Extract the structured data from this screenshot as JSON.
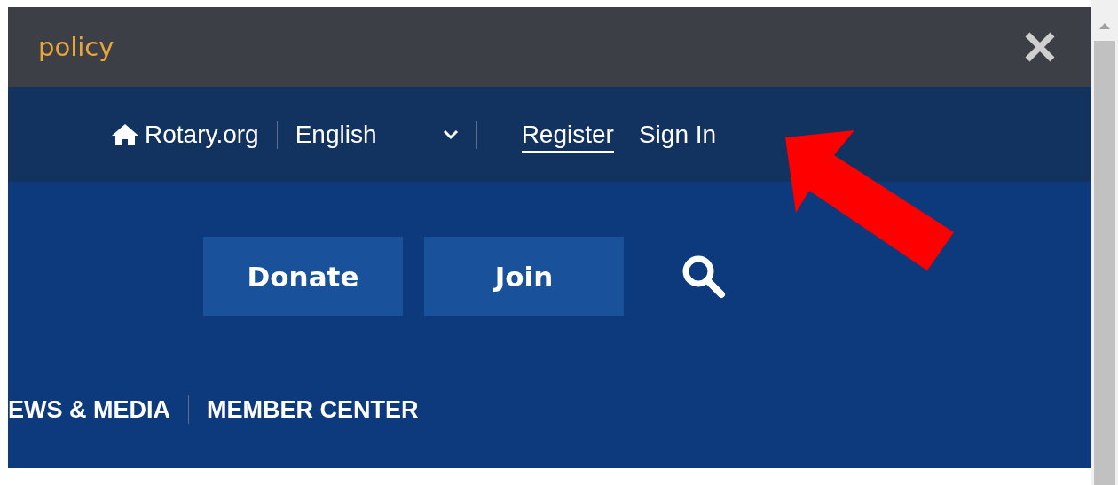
{
  "cookie_banner": {
    "text": "policy"
  },
  "top_nav": {
    "home_link": "Rotary.org",
    "language": "English",
    "links": [
      {
        "label": "Register",
        "underlined": true
      },
      {
        "label": "Sign In",
        "underlined": false
      }
    ]
  },
  "actions": [
    "Donate",
    "Join"
  ],
  "main_menu": [
    "EWS & MEDIA",
    "MEMBER CENTER"
  ]
}
